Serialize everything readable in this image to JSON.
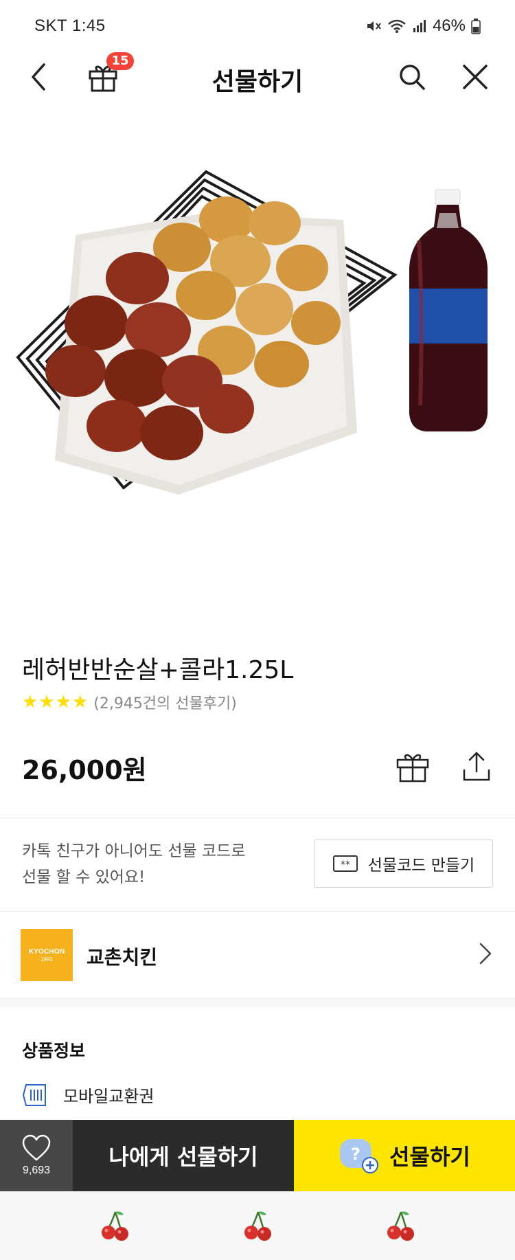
{
  "status_bar": {
    "carrier_time": "SKT 1:45",
    "battery": "46%",
    "icons": [
      "mute-icon",
      "wifi-icon",
      "signal-icon",
      "battery-icon"
    ]
  },
  "header": {
    "title": "선물하기",
    "gift_badge_count": "15",
    "icons": [
      "back-arrow-icon",
      "gift-box-icon",
      "search-icon",
      "close-icon"
    ]
  },
  "product": {
    "name": "레허반반순살+콜라1.25L",
    "rating_stars": 4,
    "review_count": "(2,945건의 선물후기)",
    "price": "26,000원",
    "star_color": "#ffdd00"
  },
  "gift_code": {
    "text_line1": "카톡 친구가 아니어도 선물 코드로",
    "text_line2": "선물 할 수 있어요!",
    "button_label": "선물코드 만들기"
  },
  "brand": {
    "name": "교촌치킨",
    "logo_line1": "KYOCHON",
    "logo_line2": "1991",
    "logo_color": "#f5b21c"
  },
  "product_info": {
    "title": "상품정보",
    "item_label": "모바일교환권"
  },
  "bottom_bar": {
    "like_count": "9,693",
    "self_gift_label": "나에게 선물하기",
    "gift_label": "선물하기",
    "gift_color": "#fee500"
  },
  "nav_bar": {
    "icons": [
      "cherry-icon",
      "cherry-icon",
      "cherry-icon"
    ]
  }
}
